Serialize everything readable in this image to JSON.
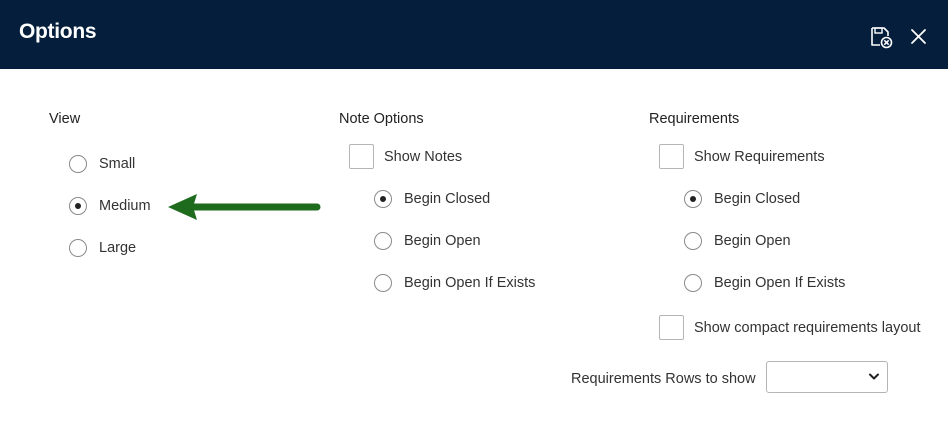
{
  "dialog": {
    "title": "Options"
  },
  "header_icons": {
    "save": "save-settings-icon",
    "close": "close-icon"
  },
  "view": {
    "title": "View",
    "options": [
      {
        "label": "Small",
        "selected": false
      },
      {
        "label": "Medium",
        "selected": true
      },
      {
        "label": "Large",
        "selected": false
      }
    ]
  },
  "notes": {
    "title": "Note Options",
    "show_label": "Show Notes",
    "show_checked": false,
    "options": [
      {
        "label": "Begin Closed",
        "selected": true
      },
      {
        "label": "Begin Open",
        "selected": false
      },
      {
        "label": "Begin Open If Exists",
        "selected": false
      }
    ]
  },
  "requirements": {
    "title": "Requirements",
    "show_label": "Show Requirements",
    "show_checked": false,
    "options": [
      {
        "label": "Begin Closed",
        "selected": true
      },
      {
        "label": "Begin Open",
        "selected": false
      },
      {
        "label": "Begin Open If Exists",
        "selected": false
      }
    ],
    "compact_label": "Show compact requirements layout",
    "compact_checked": false,
    "rows_label": "Requirements Rows to show",
    "rows_value": ""
  },
  "annotation": {
    "arrow_color": "#1e6b1e"
  },
  "colors": {
    "header_bg": "#041e3c"
  }
}
